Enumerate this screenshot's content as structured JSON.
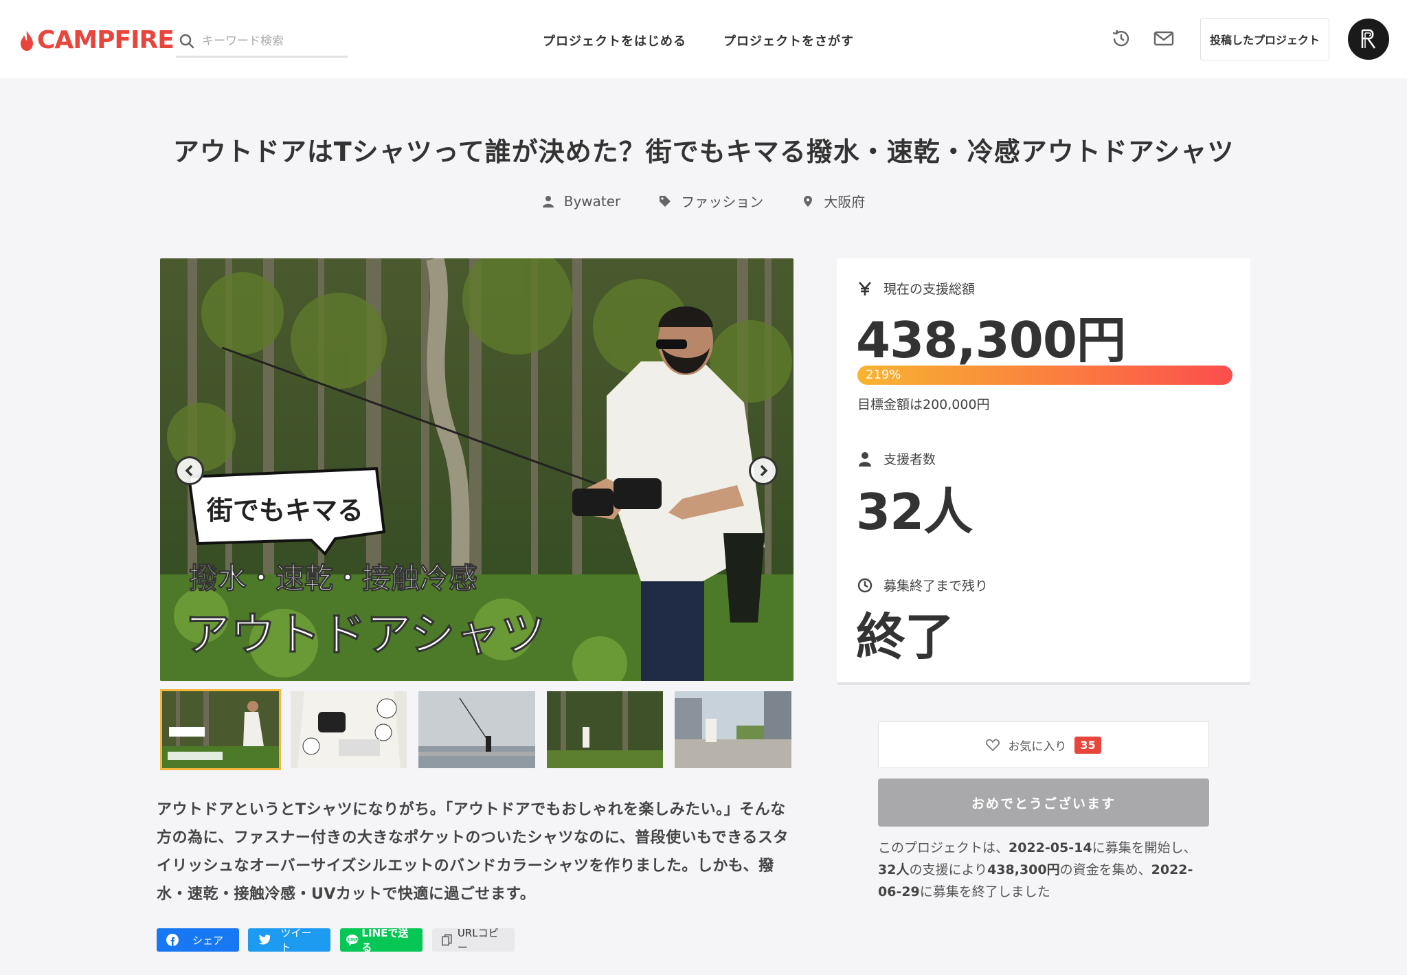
{
  "header": {
    "logo": "CAMPFIRE",
    "search_placeholder": "キーワード検索",
    "nav_start": "プロジェクトをはじめる",
    "nav_find": "プロジェクトをさがす",
    "posted_button": "投稿したプロジェクト"
  },
  "project": {
    "title": "アウトドアはTシャツって誰が決めた？街でもキマる撥水・速乾・冷感アウトドアシャツ",
    "owner": "Bywater",
    "category": "ファッション",
    "location": "大阪府",
    "image_text": {
      "bubble": "街でもキマる",
      "line1": "撥水・速乾・接触冷感",
      "line2": "アウトドアシャツ"
    },
    "description": "アウトドアというとTシャツになりがち。「アウトドアでもおしゃれを楽しみたい。」そんな方の為に、ファスナー付きの大きなポケットのついたシャツなのに、普段使いもできるスタイリッシュなオーバーサイズシルエットのバンドカラーシャツを作りました。しかも、撥水・速乾・接触冷感・UVカットで快適に過ごせます。"
  },
  "share": {
    "facebook": "シェア",
    "twitter": "ツイート",
    "line": "LINEで送る",
    "url": "URLコピー"
  },
  "stats": {
    "total_label": "現在の支援総額",
    "total_value": "438,300円",
    "progress_text": "219%",
    "progress_percent": 219,
    "goal": "目標金額は200,000円",
    "backers_label": "支援者数",
    "backers_value": "32人",
    "remaining_label": "募集終了まで残り",
    "remaining_value": "終了"
  },
  "actions": {
    "favorite_label": "お気に入り",
    "favorite_count": "35",
    "congrats_button": "おめでとうございます"
  },
  "summary": {
    "prefix": "このプロジェクトは、",
    "start_date": "2022-05-14",
    "mid1": "に募集を開始し、",
    "backers": "32人",
    "mid2": "の支援により",
    "amount": "438,300円",
    "mid3": "の資金を集め、",
    "end_date": "2022-06-29",
    "suffix": "に募集を終了しました"
  },
  "colors": {
    "brand": "#e8453c",
    "progress_start": "#f7b431",
    "progress_end": "#fb4e4e",
    "active_thumb": "#f3b73c"
  }
}
